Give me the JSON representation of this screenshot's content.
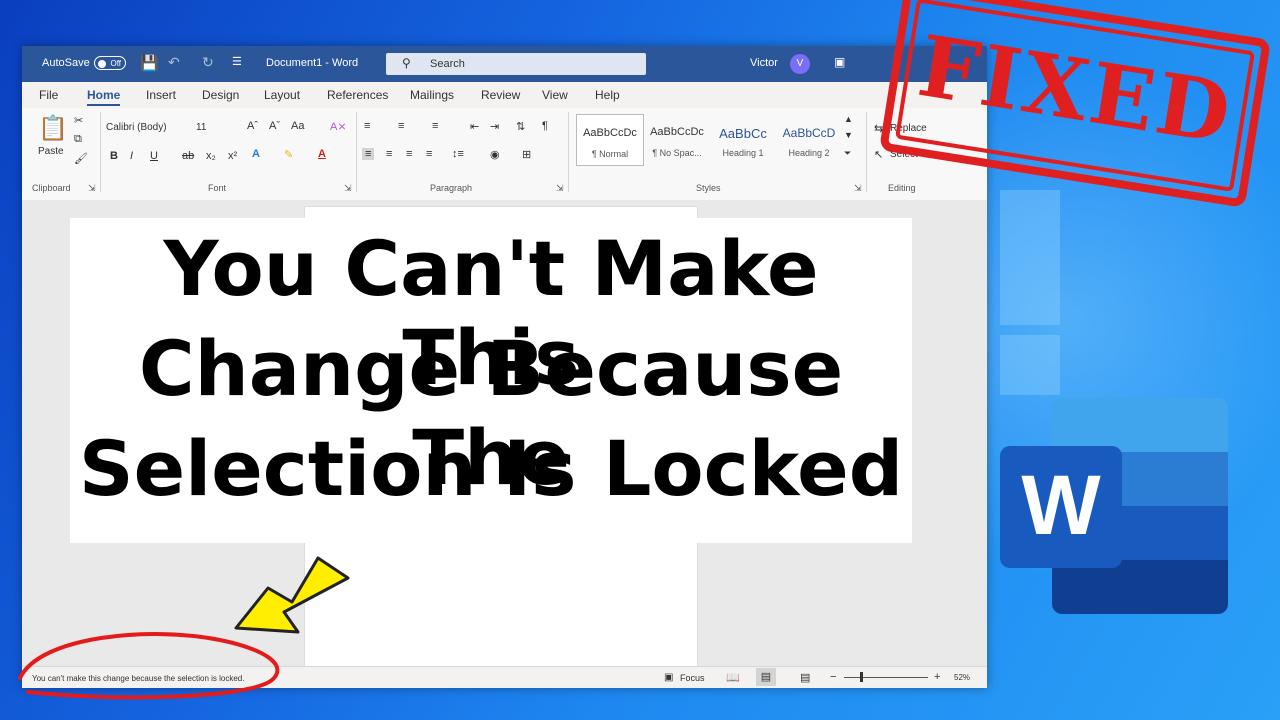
{
  "window": {
    "autosave_label": "AutoSave",
    "autosave_state": "Off",
    "doc_title": "Document1 - Word",
    "search_placeholder": "Search",
    "user_name": "Victor",
    "user_initial": "V"
  },
  "tabs": [
    "File",
    "Home",
    "Insert",
    "Design",
    "Layout",
    "References",
    "Mailings",
    "Review",
    "View",
    "Help"
  ],
  "ribbon": {
    "paste_label": "Paste",
    "font_name": "Calibri (Body)",
    "font_size": "11",
    "groups": [
      "Clipboard",
      "Font",
      "Paragraph",
      "Styles",
      "Editing"
    ],
    "styles": [
      {
        "preview": "AaBbCcDc",
        "name": "¶ Normal"
      },
      {
        "preview": "AaBbCcDc",
        "name": "¶ No Spac..."
      },
      {
        "preview": "AaBbCc",
        "name": "Heading 1"
      },
      {
        "preview": "AaBbCcD",
        "name": "Heading 2"
      }
    ],
    "replace_label": "Replace",
    "select_label": "Select"
  },
  "status": {
    "message": "You can't make this change because the selection is locked.",
    "focus_label": "Focus",
    "zoom": "52%"
  },
  "headline": {
    "line1": "You Can't Make This",
    "line2": "Change Because The",
    "line3": "Selection Is Locked"
  },
  "stamp_text": "FIXED",
  "logo_letter": "W",
  "colors": {
    "word_blue": "#2b579a",
    "stamp_red": "#e02020",
    "arrow_yellow": "#ffee00"
  }
}
